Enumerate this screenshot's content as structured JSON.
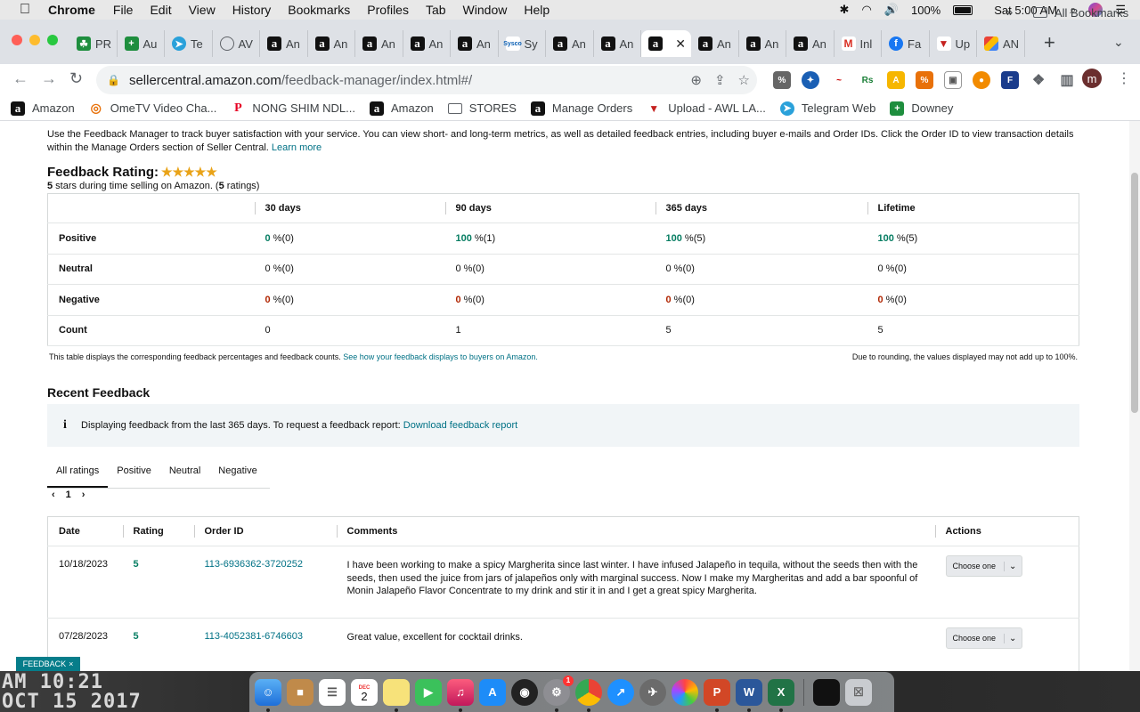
{
  "menubar": {
    "app_name": "Chrome",
    "items": [
      "File",
      "Edit",
      "View",
      "History",
      "Bookmarks",
      "Profiles",
      "Tab",
      "Window",
      "Help"
    ],
    "battery": "100%",
    "clock": "Sat 5:00 AM"
  },
  "tabs": [
    {
      "label": "PR",
      "icon": "green-icon"
    },
    {
      "label": "Au",
      "icon": "sheets-icon"
    },
    {
      "label": "Te",
      "icon": "telegram-icon"
    },
    {
      "label": "AV",
      "icon": "globe-icon"
    },
    {
      "label": "An",
      "icon": "amazon-icon"
    },
    {
      "label": "An",
      "icon": "amazon-icon"
    },
    {
      "label": "An",
      "icon": "amazon-icon"
    },
    {
      "label": "An",
      "icon": "amazon-icon"
    },
    {
      "label": "An",
      "icon": "amazon-icon"
    },
    {
      "label": "Sy",
      "icon": "sysco-icon"
    },
    {
      "label": "An",
      "icon": "amazon-icon"
    },
    {
      "label": "An",
      "icon": "amazon-icon"
    },
    {
      "label": "",
      "icon": "amazon-icon",
      "active": true
    },
    {
      "label": "An",
      "icon": "amazon-icon"
    },
    {
      "label": "An",
      "icon": "amazon-icon"
    },
    {
      "label": "An",
      "icon": "amazon-icon"
    },
    {
      "label": "Inl",
      "icon": "gmail-icon"
    },
    {
      "label": "Fa",
      "icon": "facebook-icon"
    },
    {
      "label": "Up",
      "icon": "upload-icon"
    },
    {
      "label": "AN",
      "icon": "multi-icon"
    }
  ],
  "address": {
    "host": "sellercentral.amazon.com",
    "path": "/feedback-manager/index.html#/"
  },
  "profile_initial": "m",
  "bookmarks": [
    {
      "label": "Amazon",
      "icon": "amazon-icon"
    },
    {
      "label": "OmeTV Video Cha...",
      "icon": "ometv-icon"
    },
    {
      "label": "NONG SHIM NDL...",
      "icon": "pinterest-icon"
    },
    {
      "label": "Amazon",
      "icon": "amazon-icon"
    },
    {
      "label": "STORES",
      "icon": "folder-icon"
    },
    {
      "label": "Manage Orders",
      "icon": "amazon-icon"
    },
    {
      "label": "Upload - AWL LA...",
      "icon": "upload-icon"
    },
    {
      "label": "Telegram Web",
      "icon": "telegram-icon"
    },
    {
      "label": "Downey",
      "icon": "sheets-icon"
    }
  ],
  "bookmarks_more": "»",
  "all_bookmarks": "All Bookmarks",
  "page": {
    "intro": "Use the Feedback Manager to track buyer satisfaction with your service. You can view short- and long-term metrics, as well as detailed feedback entries, including buyer e-mails and Order IDs. Click the Order ID to view transaction details within the Manage Orders section of Seller Central.",
    "learn_more": "Learn more",
    "rating_title": "Feedback Rating:",
    "stars": "★★★★★",
    "rating_sub_stars": "5",
    "rating_sub_mid": " stars during time selling on Amazon. (",
    "rating_sub_count": "5",
    "rating_sub_end": " ratings)",
    "metrics": {
      "headers": [
        "30 days",
        "90 days",
        "365 days",
        "Lifetime"
      ],
      "rows": [
        {
          "label": "Positive",
          "kind": "pos",
          "cells": [
            {
              "n": "0",
              "r": " %(0)"
            },
            {
              "n": "100",
              "r": " %(1)"
            },
            {
              "n": "100",
              "r": " %(5)"
            },
            {
              "n": "100",
              "r": " %(5)"
            }
          ]
        },
        {
          "label": "Neutral",
          "kind": "neu",
          "cells": [
            {
              "n": "0",
              "r": " %(0)"
            },
            {
              "n": "0",
              "r": " %(0)"
            },
            {
              "n": "0",
              "r": " %(0)"
            },
            {
              "n": "0",
              "r": " %(0)"
            }
          ]
        },
        {
          "label": "Negative",
          "kind": "neg",
          "cells": [
            {
              "n": "0",
              "r": " %(0)"
            },
            {
              "n": "0",
              "r": " %(0)"
            },
            {
              "n": "0",
              "r": " %(0)"
            },
            {
              "n": "0",
              "r": " %(0)"
            }
          ]
        },
        {
          "label": "Count",
          "kind": "cnt",
          "cells": [
            {
              "n": "0",
              "r": ""
            },
            {
              "n": "1",
              "r": ""
            },
            {
              "n": "5",
              "r": ""
            },
            {
              "n": "5",
              "r": ""
            }
          ]
        }
      ]
    },
    "table_note": "This table displays the corresponding feedback percentages and feedback counts.",
    "table_note_link": "See how your feedback displays to buyers on Amazon.",
    "table_note_right": "Due to rounding, the values displayed may not add up to 100%.",
    "recent_title": "Recent Feedback",
    "info_text": "Displaying feedback from the last 365 days. To request a feedback report:",
    "info_link": "Download feedback report",
    "filter_tabs": [
      "All ratings",
      "Positive",
      "Neutral",
      "Negative"
    ],
    "pager_page": "1",
    "feedback_headers": [
      "Date",
      "Rating",
      "Order ID",
      "Comments",
      "Actions"
    ],
    "feedback": [
      {
        "date": "10/18/2023",
        "rating": "5",
        "order": "113-6936362-3720252",
        "comment": "I have been working to make a spicy Margherita since last winter. I have infused Jalapeño in tequila, without the seeds then with the seeds, then used the juice from jars of jalapeños only with marginal success. Now I make my Margheritas and add a bar spoonful of Monin Jalapeño Flavor Concentrate to my drink and stir it in and I get a great spicy Margherita.",
        "action": "Choose one"
      },
      {
        "date": "07/28/2023",
        "rating": "5",
        "order": "113-4052381-6746603",
        "comment": "Great value, excellent for cocktail drinks.",
        "action": "Choose one"
      }
    ],
    "feedback_tab": "FEEDBACK"
  },
  "desktop_text": [
    "AM 10:21",
    "OCT 15 2017"
  ],
  "dock": {
    "calendar_day": "2",
    "calendar_month": "DEC",
    "badge": "1"
  }
}
